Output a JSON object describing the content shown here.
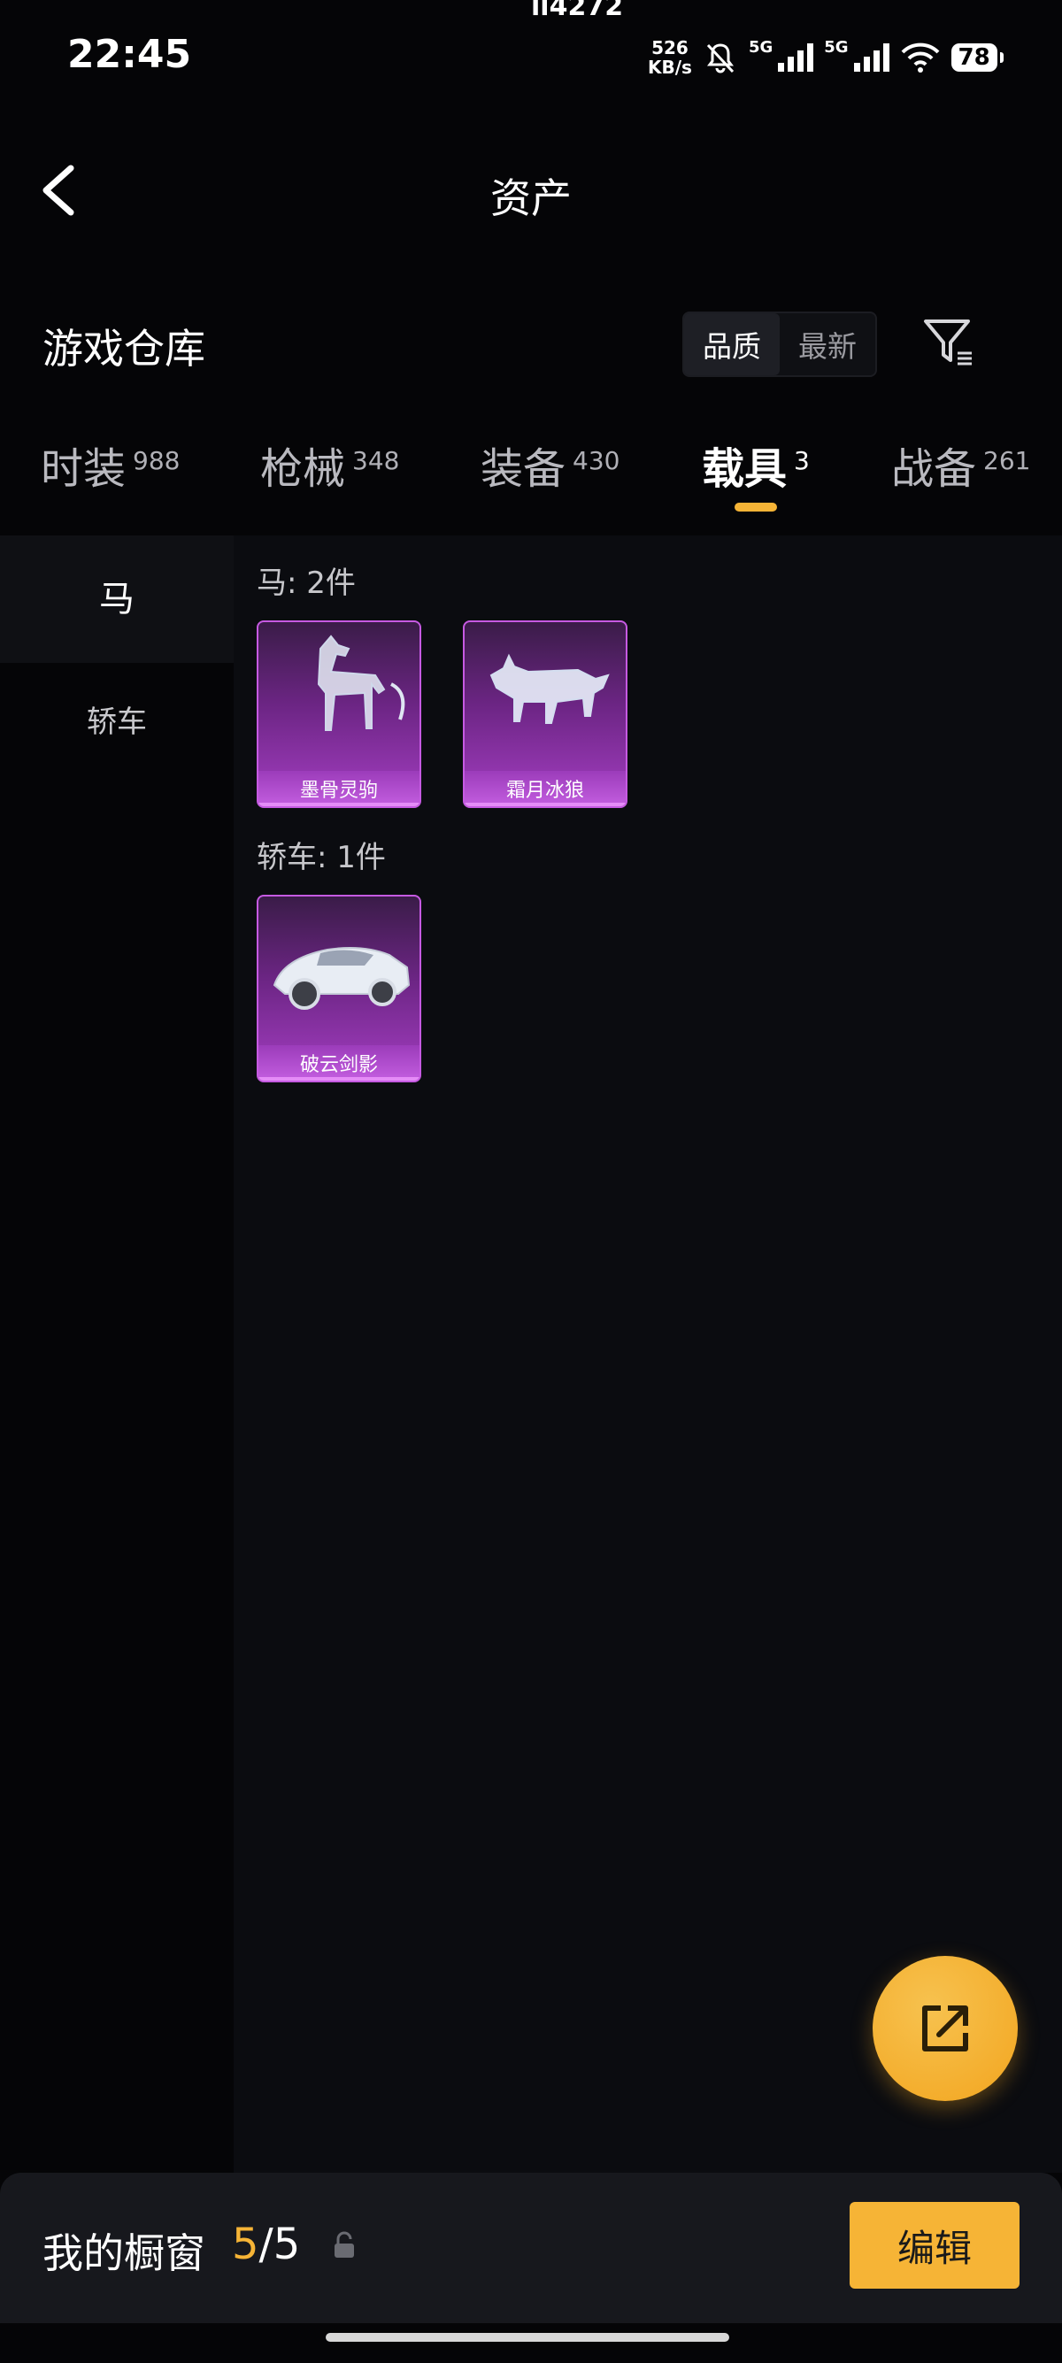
{
  "status_bar": {
    "time": "22:45",
    "carrier_text": "ll4272",
    "speed_value": "526",
    "speed_unit": "KB/s",
    "network_1": "5G",
    "network_2": "5G",
    "battery": "78"
  },
  "header": {
    "title": "资产",
    "back_icon": "chevron-left-icon"
  },
  "warehouse": {
    "title": "游戏仓库",
    "sort_options": [
      "品质",
      "最新"
    ],
    "sort_selected": "品质",
    "filter_icon": "filter-icon"
  },
  "tabs": [
    {
      "label": "时装",
      "count": "988"
    },
    {
      "label": "枪械",
      "count": "348"
    },
    {
      "label": "装备",
      "count": "430"
    },
    {
      "label": "载具",
      "count": "3",
      "active": true
    },
    {
      "label": "战备",
      "count": "261"
    }
  ],
  "sidebar": {
    "items": [
      "马",
      "轿车"
    ],
    "active": "马"
  },
  "sections": [
    {
      "label": "马: 2件",
      "items": [
        {
          "name": "墨骨灵驹",
          "art": "horse-art"
        },
        {
          "name": "霜月冰狼",
          "art": "wolf-art"
        }
      ]
    },
    {
      "label": "轿车: 1件",
      "items": [
        {
          "name": "破云剑影",
          "art": "car-art"
        }
      ]
    }
  ],
  "fab": {
    "icon": "share-icon"
  },
  "showcase": {
    "label": "我的橱窗",
    "current": "5",
    "separator": "/",
    "total": "5",
    "lock_icon": "lock-icon",
    "edit_label": "编辑"
  },
  "colors": {
    "accent": "#f6b436",
    "card_purple": "#a43ec2",
    "background": "#050507"
  }
}
